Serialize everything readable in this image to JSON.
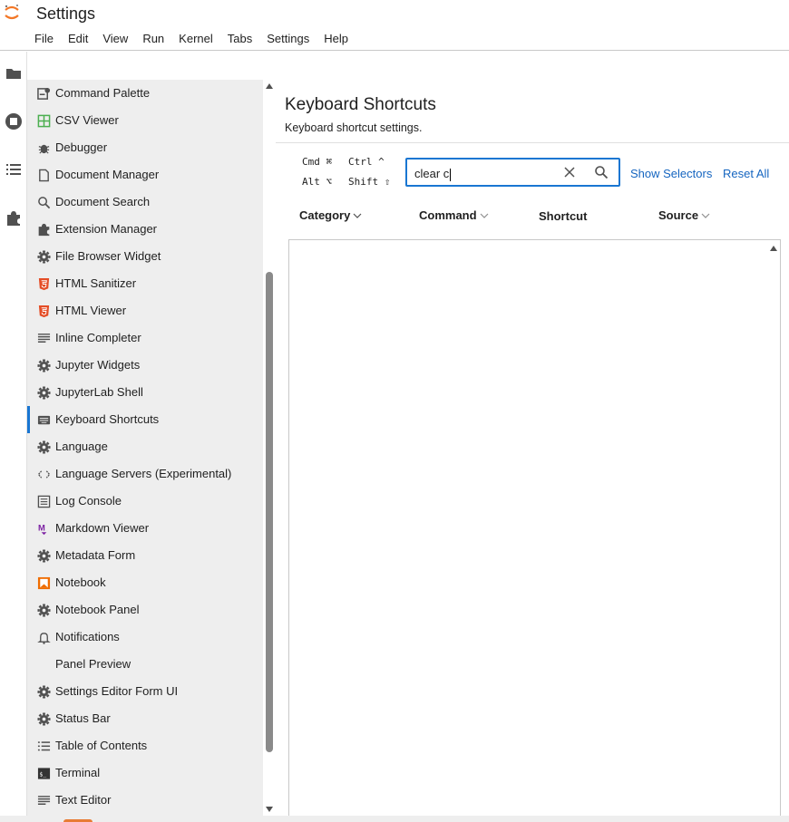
{
  "app": {
    "title": "Settings"
  },
  "menubar": [
    "File",
    "Edit",
    "View",
    "Run",
    "Kernel",
    "Tabs",
    "Settings",
    "Help"
  ],
  "activity_bar": [
    "folder-icon",
    "running-icon",
    "toc-icon",
    "extension-icon"
  ],
  "sidebar": {
    "items": [
      {
        "label": "Command Palette",
        "icon": "palette-icon"
      },
      {
        "label": "CSV Viewer",
        "icon": "spreadsheet-icon"
      },
      {
        "label": "Debugger",
        "icon": "bug-icon"
      },
      {
        "label": "Document Manager",
        "icon": "file-icon"
      },
      {
        "label": "Document Search",
        "icon": "search-icon"
      },
      {
        "label": "Extension Manager",
        "icon": "extension-icon"
      },
      {
        "label": "File Browser Widget",
        "icon": "gear-icon"
      },
      {
        "label": "HTML Sanitizer",
        "icon": "html5-icon"
      },
      {
        "label": "HTML Viewer",
        "icon": "html5-icon"
      },
      {
        "label": "Inline Completer",
        "icon": "lines-icon"
      },
      {
        "label": "Jupyter Widgets",
        "icon": "gear-icon"
      },
      {
        "label": "JupyterLab Shell",
        "icon": "gear-icon"
      },
      {
        "label": "Keyboard Shortcuts",
        "icon": "keyboard-icon"
      },
      {
        "label": "Language",
        "icon": "gear-icon"
      },
      {
        "label": "Language Servers (Experimental)",
        "icon": "code-icon"
      },
      {
        "label": "Log Console",
        "icon": "list-icon"
      },
      {
        "label": "Markdown Viewer",
        "icon": "markdown-icon"
      },
      {
        "label": "Metadata Form",
        "icon": "gear-icon"
      },
      {
        "label": "Notebook",
        "icon": "notebook-icon"
      },
      {
        "label": "Notebook Panel",
        "icon": "gear-icon"
      },
      {
        "label": "Notifications",
        "icon": "bell-icon"
      },
      {
        "label": "Panel Preview",
        "icon": ""
      },
      {
        "label": "Settings Editor Form UI",
        "icon": "gear-icon"
      },
      {
        "label": "Status Bar",
        "icon": "gear-icon"
      },
      {
        "label": "Table of Contents",
        "icon": "toc-icon"
      },
      {
        "label": "Terminal",
        "icon": "terminal-icon"
      },
      {
        "label": "Text Editor",
        "icon": "lines-icon"
      }
    ],
    "selected": "Keyboard Shortcuts"
  },
  "panel": {
    "title": "Keyboard Shortcuts",
    "subtitle": "Keyboard shortcut settings.",
    "modifiers": {
      "cmd": "Cmd ⌘",
      "ctrl": "Ctrl ^",
      "alt": "Alt ⌥",
      "shift": "Shift ⇧"
    },
    "search": {
      "value": "clear c",
      "placeholder": ""
    },
    "show_selectors": "Show Selectors",
    "reset_all": "Reset All",
    "columns": {
      "category": "Category",
      "command": "Command",
      "shortcut": "Shortcut",
      "source": "Source"
    }
  },
  "colors": {
    "accent": "#1976d2",
    "link": "#1565c0",
    "sidebar_bg": "#eeeeee",
    "jupyter_orange": "#f37726"
  }
}
